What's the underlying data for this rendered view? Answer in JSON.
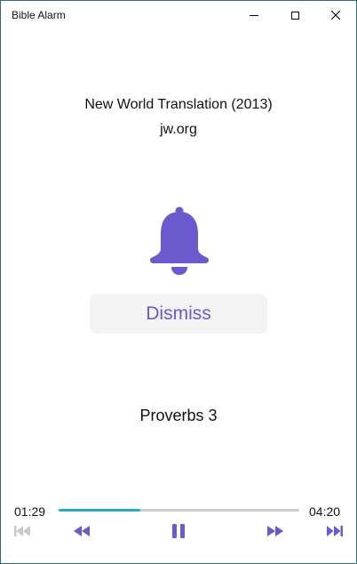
{
  "window": {
    "title": "Bible Alarm",
    "controls": {
      "minimize": "minimize-icon",
      "maximize": "maximize-icon",
      "close": "close-icon"
    }
  },
  "header": {
    "translation": "New World Translation (2013)",
    "site": "jw.org"
  },
  "alarm": {
    "icon": "bell-icon",
    "dismiss_label": "Dismiss",
    "reading": "Proverbs 3"
  },
  "player": {
    "current_time": "01:29",
    "duration": "04:20",
    "progress": 0.34,
    "controls": [
      "skip-previous-icon",
      "rewind-icon",
      "pause-icon",
      "fast-forward-icon",
      "skip-next-icon"
    ],
    "prev_track_enabled": false
  },
  "colors": {
    "accent": "#6a5acd",
    "progress_fill": "#29a8c8",
    "progress_track": "#cccccc",
    "disabled": "#c8c8c8",
    "button_bg": "#f3f3f3",
    "border": "#2b6e7a"
  }
}
